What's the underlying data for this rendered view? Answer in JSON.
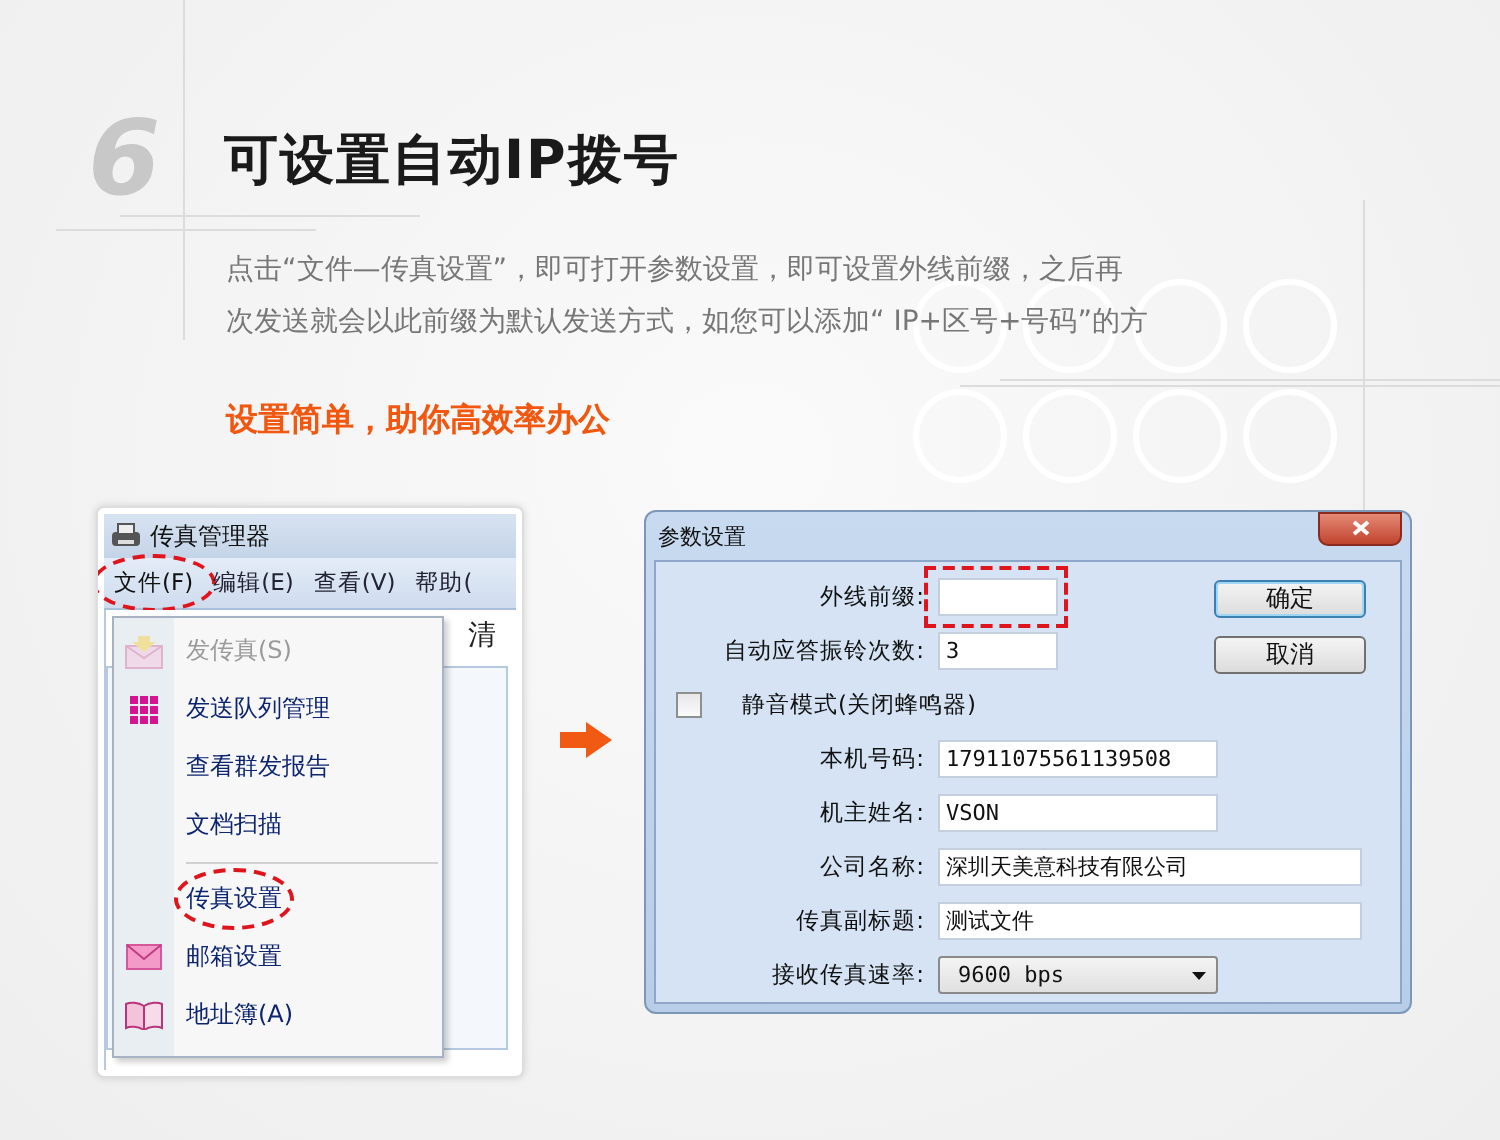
{
  "header": {
    "step_number": "6",
    "title": "可设置自动IP拨号"
  },
  "paragraph_lines": [
    "点击“文件—传真设置”，即可打开参数设置，即可设置外线前缀，之后再",
    "次发送就会以此前缀为默认发送方式，如您可以添加“ IP+区号+号码”的方"
  ],
  "tagline": "设置简单，助你高效率办公",
  "fax_window": {
    "title": "传真管理器",
    "menus": [
      {
        "label": "文件(F)",
        "highlighted": true
      },
      {
        "label": "编辑(E)",
        "highlighted": false
      },
      {
        "label": "查看(V)",
        "highlighted": false
      },
      {
        "label": "帮助(",
        "highlighted": false
      }
    ],
    "background_text": "清",
    "dropdown_groups": [
      [
        {
          "label": "发传真(S)",
          "kind": "send",
          "disabled": true,
          "highlighted": false
        },
        {
          "label": "发送队列管理",
          "kind": "grid",
          "disabled": false,
          "highlighted": false
        },
        {
          "label": "查看群发报告",
          "kind": "plain",
          "disabled": false,
          "highlighted": false
        },
        {
          "label": "文档扫描",
          "kind": "plain",
          "disabled": false,
          "highlighted": false
        }
      ],
      [
        {
          "label": "传真设置",
          "kind": "plain",
          "disabled": false,
          "highlighted": true
        },
        {
          "label": "邮箱设置",
          "kind": "mail",
          "disabled": false,
          "highlighted": false
        },
        {
          "label": "地址簿(A)",
          "kind": "book",
          "disabled": false,
          "highlighted": false
        }
      ]
    ]
  },
  "dialog": {
    "title": "参数设置",
    "buttons": [
      "确定",
      "取消"
    ],
    "fields": [
      {
        "kind": "text",
        "label": "外线前缀:",
        "highlighted": true
      },
      {
        "kind": "text",
        "label": "自动应答振铃次数:",
        "value": "3",
        "highlighted": false
      },
      {
        "kind": "checkbox",
        "label": "静音模式(关闭蜂鸣器)",
        "checked": false
      },
      {
        "kind": "text",
        "label": "本机号码:",
        "value": "17911075561139508",
        "highlighted": false
      },
      {
        "kind": "text",
        "label": "机主姓名:",
        "value": "VSON",
        "highlighted": false
      },
      {
        "kind": "text",
        "label": "公司名称:",
        "value": "深圳天美意科技有限公司",
        "highlighted": false
      },
      {
        "kind": "text",
        "label": "传真副标题:",
        "value": "测试文件",
        "highlighted": false
      },
      {
        "kind": "select",
        "label": "接收传真速率:",
        "value": "9600 bps"
      }
    ]
  }
}
